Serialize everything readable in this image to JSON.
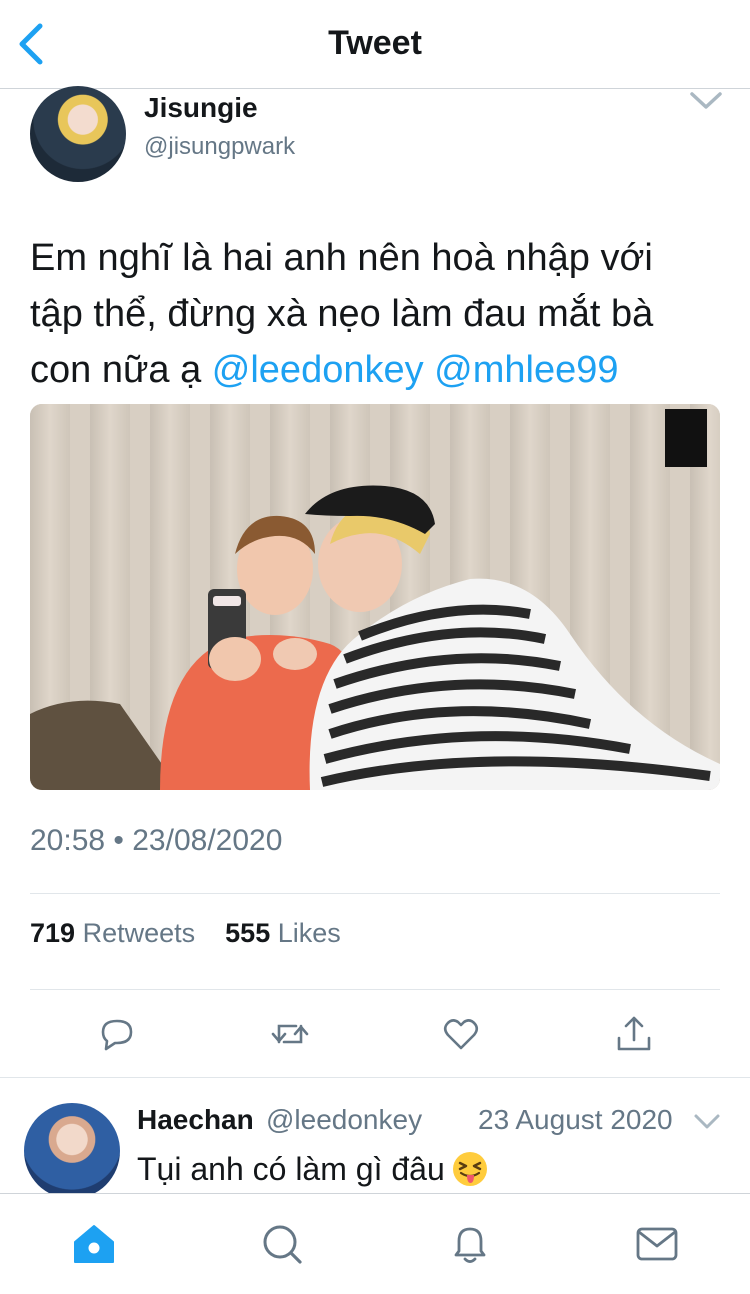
{
  "header": {
    "title": "Tweet"
  },
  "tweet": {
    "author_name": "Jisungie",
    "author_handle": "@jisungpwark",
    "text_line1": "Em nghĩ là hai anh nên hoà nhập với",
    "text_line2": "tập thể, đừng xà nẹo làm đau mắt bà",
    "text_line3_prefix": "con nữa ạ ",
    "mention1": "@leedonkey",
    "mention2": "@mhlee99",
    "timestamp": "20:58 • 23/08/2020",
    "retweet_count": "719",
    "retweet_label": "Retweets",
    "like_count": "555",
    "like_label": "Likes"
  },
  "actions": [
    "reply-icon",
    "retweet-icon",
    "like-icon",
    "share-icon"
  ],
  "reply": {
    "author_name": "Haechan",
    "author_handle": "@leedonkey",
    "date": "23 August 2020",
    "text": "Tụi anh có làm gì đâu"
  },
  "tabs": [
    "home-icon",
    "search-icon",
    "notifications-icon",
    "messages-icon"
  ],
  "colors": {
    "accent": "#1da1f2",
    "secondary_text": "#657786",
    "divider": "#e1e6ea"
  }
}
